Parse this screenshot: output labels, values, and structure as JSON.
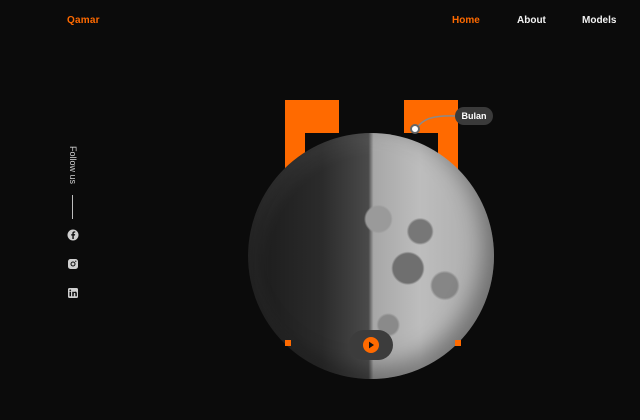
{
  "brand": "Qamar",
  "nav": {
    "items": [
      "Home",
      "About",
      "Models"
    ],
    "active": "Home"
  },
  "side": {
    "follow_label": "Follow us",
    "socials": [
      "facebook-icon",
      "instagram-icon",
      "linkedin-icon"
    ]
  },
  "hero": {
    "tag_label": "Bulan"
  },
  "colors": {
    "accent": "#ff6a00",
    "background": "#0b0b0b",
    "text": "#f2f2f2",
    "badge": "#3a3a3a"
  }
}
